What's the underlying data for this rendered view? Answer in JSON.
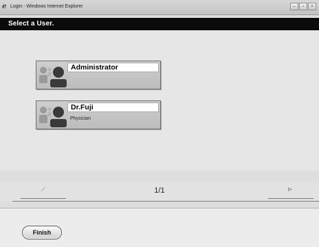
{
  "window": {
    "title": "Login - Windows Internet Explorer",
    "buttons": [
      {
        "name": "minimize",
        "glyph": "–"
      },
      {
        "name": "restore",
        "glyph": "▫"
      },
      {
        "name": "close",
        "glyph": "×"
      }
    ]
  },
  "header": {
    "title": "Select a User."
  },
  "users": [
    {
      "name": "Administrator",
      "role": ""
    },
    {
      "name": "Dr.Fuji",
      "role": "Physician"
    }
  ],
  "pager": {
    "page": "1/1",
    "prev_glyph": "⟋",
    "next_glyph": "⊳"
  },
  "footer": {
    "finish_label": "Finish"
  },
  "icons": {
    "browser": "ie-icon",
    "user": "user-group-icon"
  },
  "colors": {
    "header_bg": "#0b0b0b",
    "header_text": "#ffffff",
    "card_bg": "#c6c6c6",
    "avatar_dark": "#3a3a3a",
    "avatar_light": "#9a9a9a"
  }
}
